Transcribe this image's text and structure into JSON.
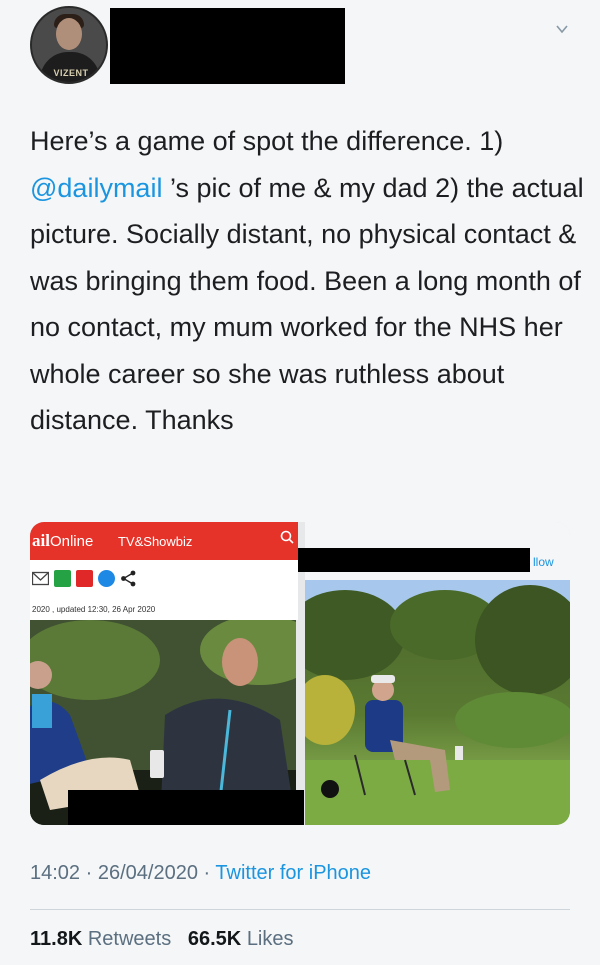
{
  "tweet": {
    "avatar_shirt_text": "VIZENT",
    "text_before_mention": "Here’s a game of spot the difference. 1) ",
    "mention": "@dailymail",
    "text_after_mention": " ’s pic of me & my dad 2) the actual picture. Socially distant, no physical contact & was bringing them food. Been a long month of no contact, my mum worked for the NHS her whole career so she was ruthless about distance. Thanks",
    "time": "14:02",
    "separator": "·",
    "date": "26/04/2020",
    "source": "Twitter for iPhone",
    "retweets_count": "11.8K",
    "retweets_label": "Retweets",
    "likes_count": "66.5K",
    "likes_label": "Likes"
  },
  "media": {
    "dailymail": {
      "brand": "ail",
      "brand_suffix": "Online",
      "section": "TV&Showbiz",
      "date_line": "2020 , updated 12:30, 26 Apr 2020",
      "icons": [
        "email-icon",
        "whatsapp-icon",
        "flipboard-icon",
        "messenger-icon",
        "share-icon"
      ]
    },
    "right_follow_label": "llow"
  },
  "colors": {
    "mention": "#1b95e0",
    "dailymail_red": "#e6332a",
    "meta_gray": "#5b6f80"
  }
}
